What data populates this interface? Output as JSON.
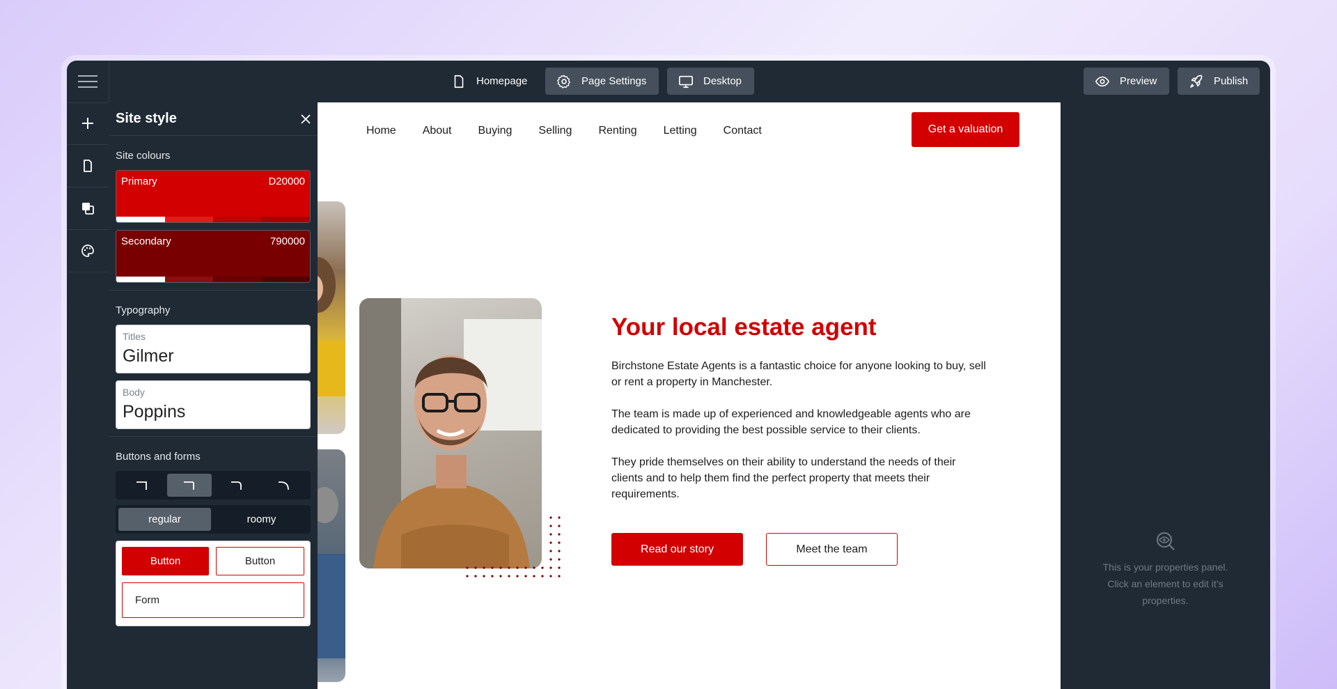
{
  "topbar": {
    "page_label": "Homepage",
    "page_settings_label": "Page Settings",
    "device_label": "Desktop",
    "preview_label": "Preview",
    "publish_label": "Publish"
  },
  "site_style": {
    "title": "Site style",
    "colours_label": "Site colours",
    "colours": [
      {
        "name": "Primary",
        "hex": "D20000",
        "color": "#d20000"
      },
      {
        "name": "Secondary",
        "hex": "790000",
        "color": "#790000"
      }
    ],
    "typography_label": "Typography",
    "fonts": [
      {
        "label": "Titles",
        "value": "Gilmer"
      },
      {
        "label": "Body",
        "value": "Poppins"
      }
    ],
    "buttons_label": "Buttons and forms",
    "density_options": [
      "regular",
      "roomy"
    ],
    "density_selected": "regular",
    "preview_button_label": "Button",
    "preview_form_label": "Form"
  },
  "website": {
    "nav": [
      "Home",
      "About",
      "Buying",
      "Selling",
      "Renting",
      "Letting",
      "Contact"
    ],
    "cta_label": "Get a valuation",
    "headline": "Your local estate agent",
    "paragraphs": [
      "Birchstone Estate Agents is a fantastic choice for anyone looking to buy, sell or rent a property in Manchester.",
      "The team is made up of experienced and knowledgeable agents who are dedicated to providing the best possible service to their clients.",
      "They pride themselves on their ability to understand the needs of their clients and to help them find the perfect property that meets their requirements."
    ],
    "primary_button_label": "Read our story",
    "secondary_button_label": "Meet the team"
  },
  "properties_panel": {
    "empty_line1": "This is your properties panel.",
    "empty_line2": "Click an element to edit it’s",
    "empty_line3": "properties."
  },
  "colors": {
    "app_bg": "#1f2a35",
    "brand_primary": "#d20000",
    "brand_secondary": "#790000"
  }
}
